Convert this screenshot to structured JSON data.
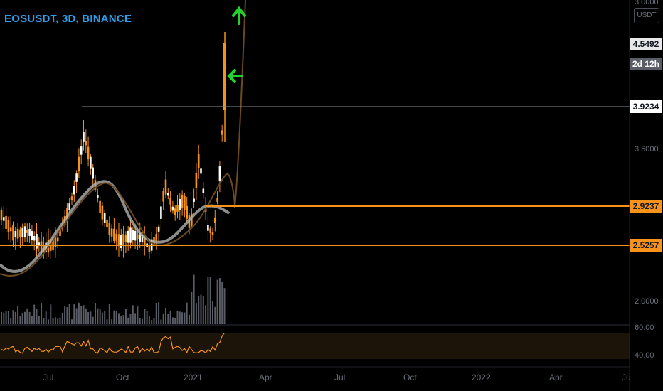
{
  "header": {
    "symbol_title": "EOSUSDT, 3D, BINANCE"
  },
  "price_axis": {
    "currency": "USDT",
    "ticks": [
      "3.0000",
      "3.5000",
      "2.0000"
    ],
    "rsi_ticks": [
      "60.00",
      "40.00"
    ],
    "last_price": "4.5492",
    "countdown": "2d 12h",
    "levels": [
      "3.9234",
      "2.9237",
      "2.5257"
    ]
  },
  "time_axis": {
    "labels": [
      "Jul",
      "Oct",
      "2021",
      "Apr",
      "Jul",
      "Oct",
      "2022",
      "Apr",
      "Ju"
    ]
  },
  "colors": {
    "background": "#000000",
    "candle": "#f7931a",
    "candle_bull": "#ffffff",
    "level_white": "#8a8d94",
    "level_orange": "#f7931a",
    "arrows": "#22d32b",
    "sma": "#b0b0b0",
    "projection": "#6b4a1e"
  }
}
